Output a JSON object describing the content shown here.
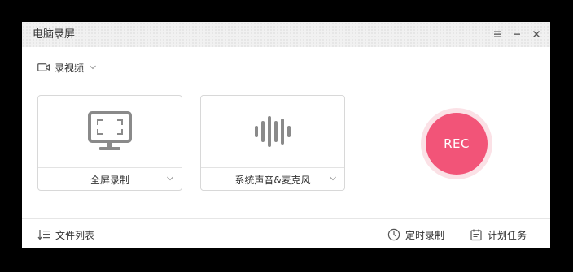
{
  "window": {
    "title": "电脑录屏"
  },
  "mode": {
    "selected": "录视频"
  },
  "sources": [
    {
      "label": "全屏录制",
      "icon": "monitor-fullscreen-icon"
    },
    {
      "label": "系统声音&麦克风",
      "icon": "sound-wave-icon"
    }
  ],
  "record": {
    "label": "REC"
  },
  "footer": {
    "file_list": "文件列表",
    "timed_record": "定时录制",
    "scheduled_task": "计划任务"
  },
  "colors": {
    "accent": "#f25478",
    "accent_ring": "#fbe1e6",
    "icon_gray": "#8a8a8a"
  }
}
